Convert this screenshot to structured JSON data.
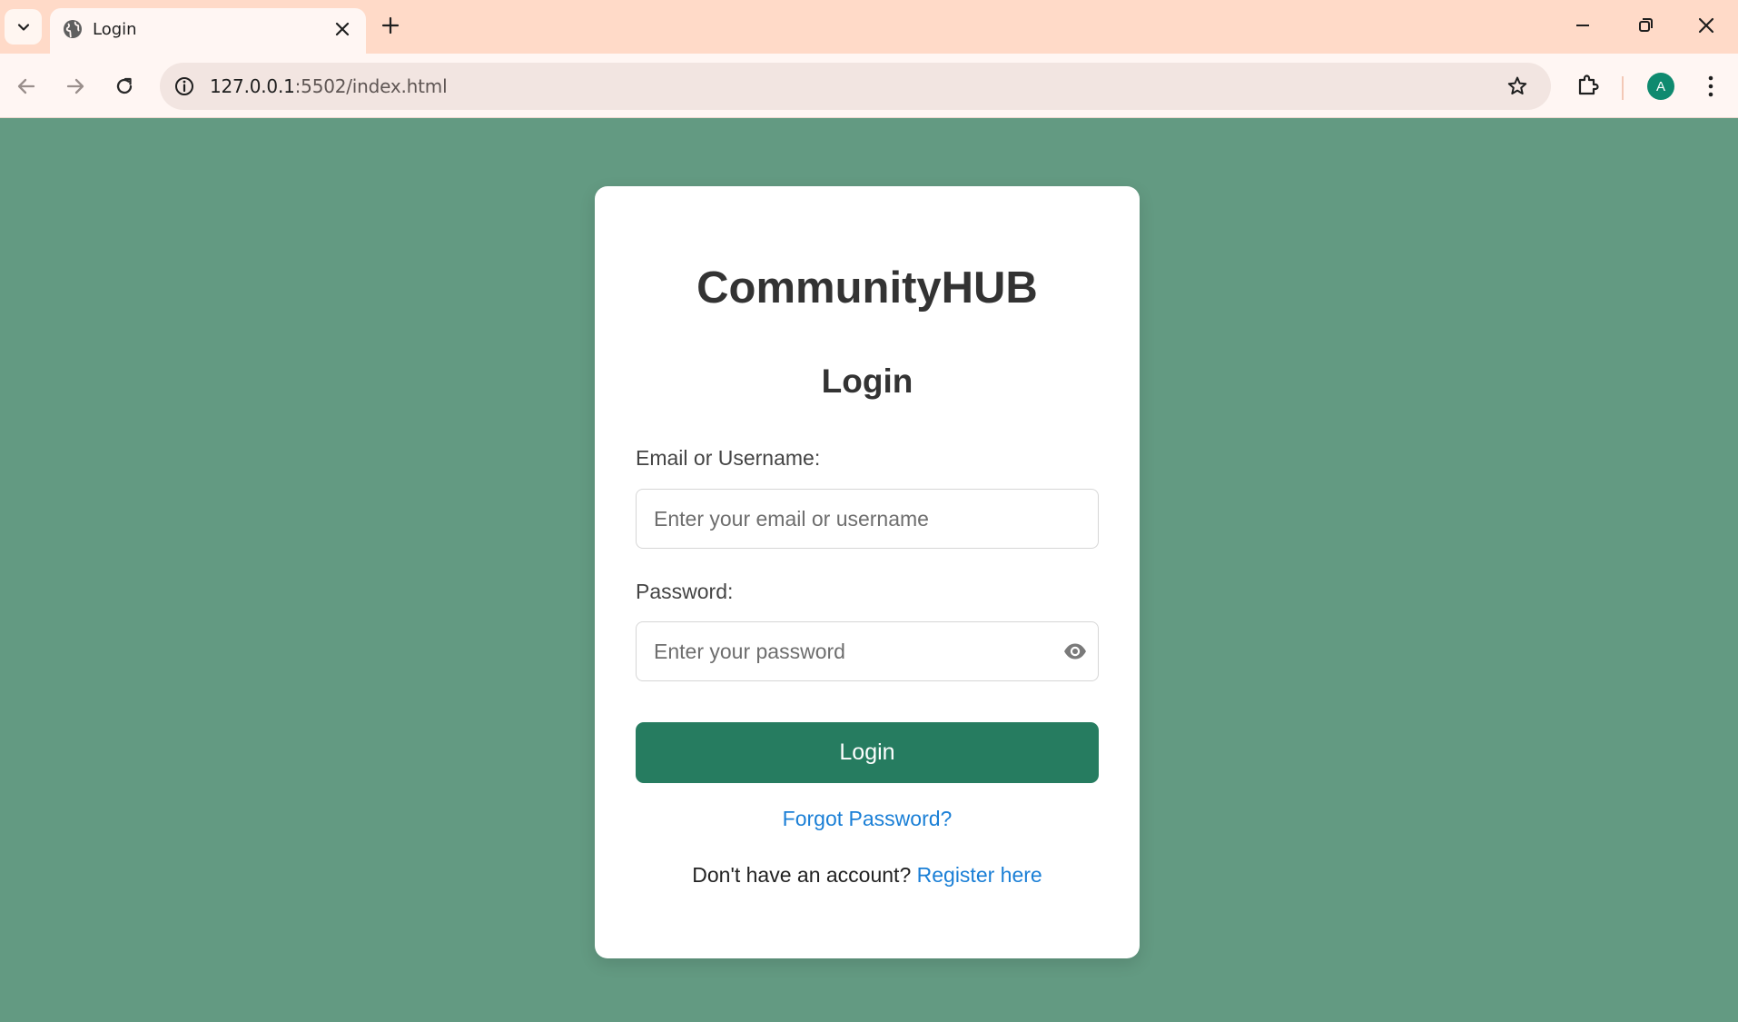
{
  "browser": {
    "tab_title": "Login",
    "url_host": "127.0.0.1",
    "url_path": ":5502/index.html",
    "avatar_letter": "A"
  },
  "login": {
    "brand": "CommunityHUB",
    "heading": "Login",
    "email_label": "Email or Username:",
    "email_placeholder": "Enter your email or username",
    "email_value": "",
    "password_label": "Password:",
    "password_placeholder": "Enter your password",
    "password_value": "",
    "submit_label": "Login",
    "forgot_link": "Forgot Password?",
    "register_prompt": "Don't have an account?",
    "register_link": "Register here"
  },
  "colors": {
    "page_background": "#639a82",
    "button": "#267c60",
    "link": "#1a7fd6",
    "tabbar": "#ffdac8"
  }
}
